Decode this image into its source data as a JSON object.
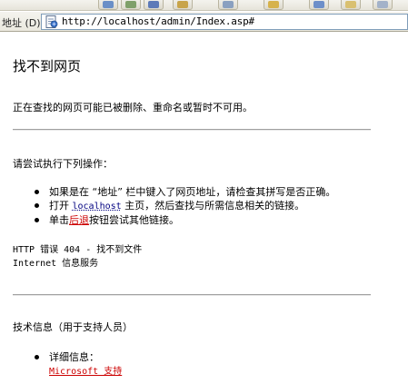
{
  "browser": {
    "address_label": "地址 (D)",
    "url": "http://localhost/admin/Index.asp#"
  },
  "page": {
    "title": "找不到网页",
    "description": "正在查找的网页可能已被删除、重命名或暂时不可用。",
    "try_heading": "请尝试执行下列操作：",
    "item1": "如果是在 “地址” 栏中键入了网页地址，请检查其拼写是否正确。",
    "item2_before": "打开 ",
    "item2_link": "localhost",
    "item2_after": " 主页，然后查找与所需信息相关的链接。",
    "item3_before": "单击",
    "item3_link": "后退",
    "item3_after": "按钮尝试其他链接。",
    "error_line1": "HTTP 错误 404 - 找不到文件",
    "error_line2": "Internet 信息服务",
    "tech_heading": "技术信息（用于支持人员）",
    "details_label": "详细信息：",
    "support_link": "Microsoft 支持"
  },
  "colors": {
    "link": "#cc0000",
    "address_border": "#7f9db9"
  },
  "icons": [
    "page-icon"
  ]
}
